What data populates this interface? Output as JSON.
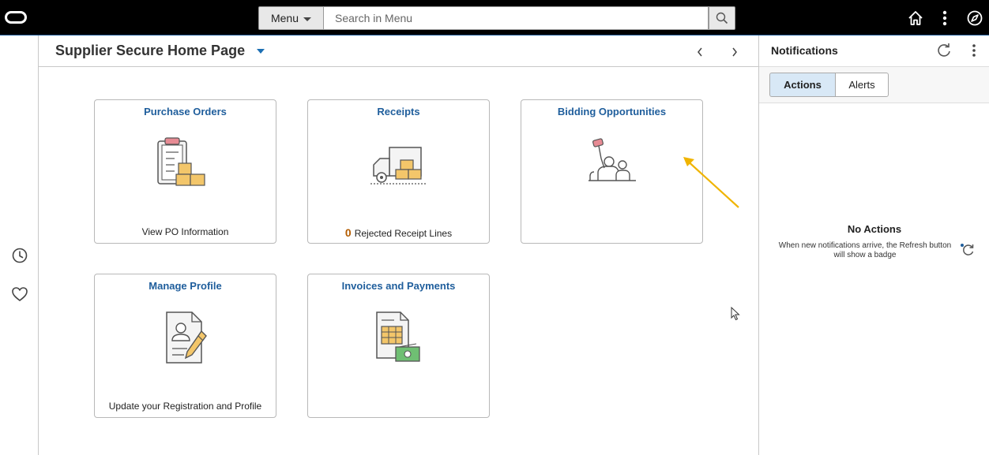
{
  "topbar": {
    "menu_label": "Menu",
    "search_placeholder": "Search in Menu"
  },
  "page": {
    "title": "Supplier Secure Home Page"
  },
  "tiles": [
    {
      "title": "Purchase Orders",
      "footer": "View PO Information"
    },
    {
      "title": "Receipts",
      "count": "0",
      "footer": "Rejected Receipt Lines"
    },
    {
      "title": "Bidding Opportunities",
      "footer": ""
    },
    {
      "title": "Manage Profile",
      "footer": "Update your Registration and Profile"
    },
    {
      "title": "Invoices and Payments",
      "footer": ""
    }
  ],
  "notifications": {
    "title": "Notifications",
    "tabs": [
      {
        "label": "Actions",
        "active": true
      },
      {
        "label": "Alerts",
        "active": false
      }
    ],
    "empty_title": "No Actions",
    "empty_message": "When new notifications arrive, the Refresh button will show a badge"
  },
  "colors": {
    "tile_title": "#1f5e9c",
    "count": "#b35c00",
    "active_tab": "#d8e8f6",
    "annotation_arrow": "#f0b400"
  },
  "icons": [
    "oracle-logo",
    "search-icon",
    "home-icon",
    "more-vertical-icon",
    "navbar-compass-icon",
    "recent-history-icon",
    "favorites-heart-icon",
    "refresh-icon"
  ]
}
